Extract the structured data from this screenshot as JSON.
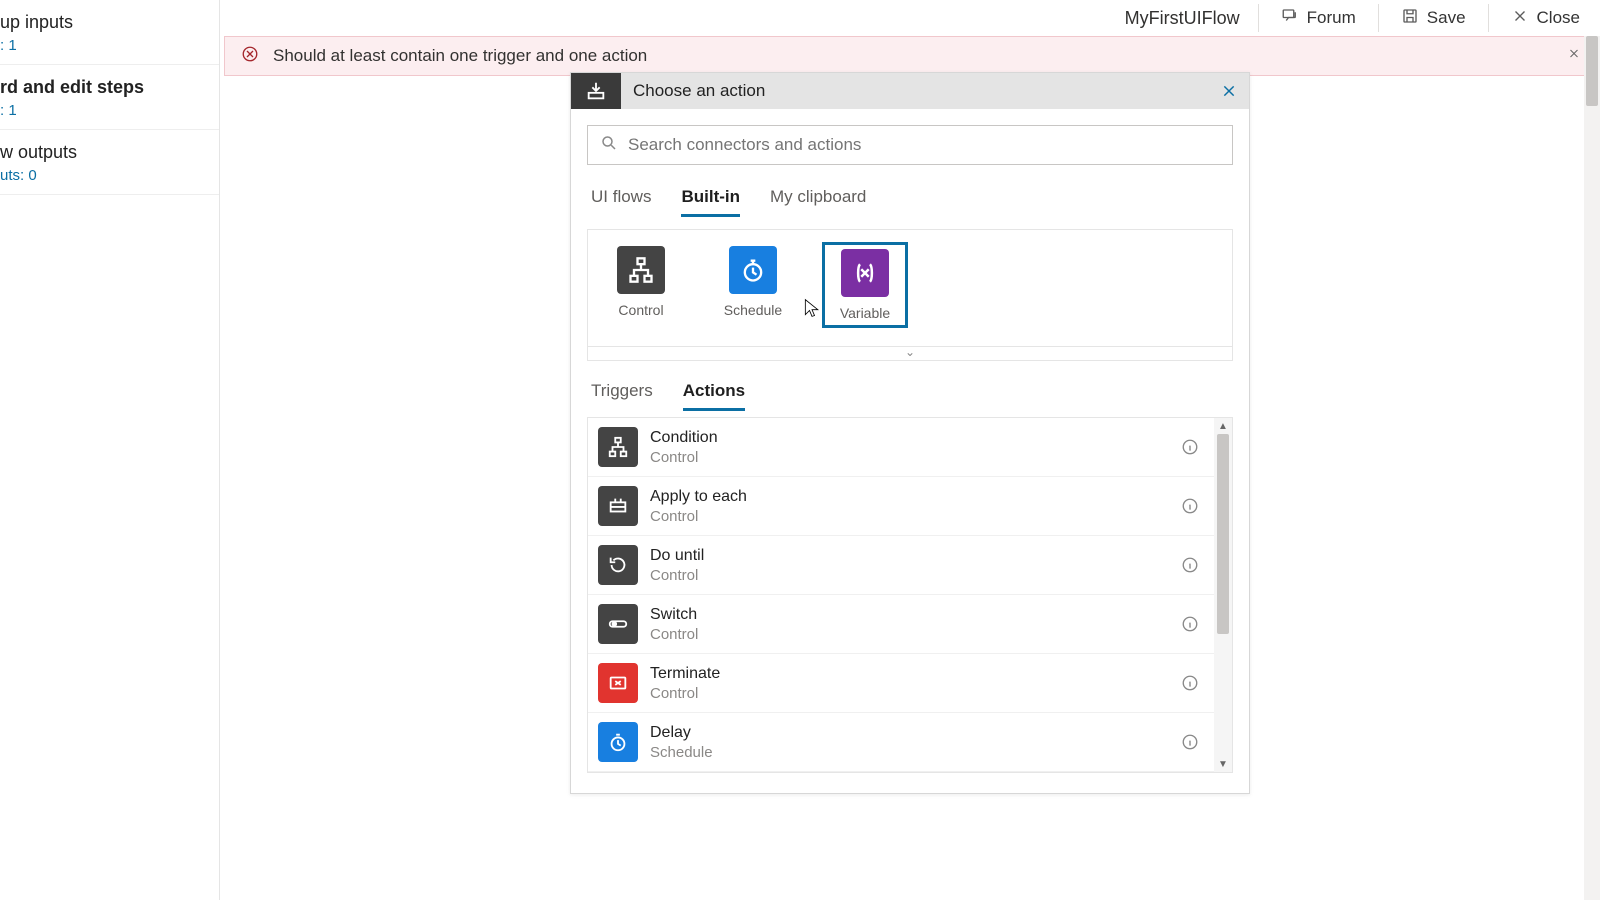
{
  "topbar": {
    "flow_name": "MyFirstUIFlow",
    "forum": "Forum",
    "save": "Save",
    "close": "Close"
  },
  "sidebar": {
    "groups": [
      {
        "title": "up inputs",
        "sub": ": 1",
        "bold": false
      },
      {
        "title": "rd and edit steps",
        "sub": ": 1",
        "bold": true
      },
      {
        "title": "w outputs",
        "sub": "uts: 0",
        "bold": false
      }
    ]
  },
  "banner": {
    "message": "Should at least contain one trigger and one action"
  },
  "card": {
    "title": "Choose an action",
    "search_placeholder": "Search connectors and actions",
    "pivot": {
      "uiflows": "UI flows",
      "builtin": "Built-in",
      "clipboard": "My clipboard"
    },
    "tiles": {
      "control": "Control",
      "schedule": "Schedule",
      "variable": "Variable"
    },
    "subpivot": {
      "triggers": "Triggers",
      "actions": "Actions"
    },
    "actions": [
      {
        "name": "Condition",
        "cat": "Control",
        "color": "#444"
      },
      {
        "name": "Apply to each",
        "cat": "Control",
        "color": "#444"
      },
      {
        "name": "Do until",
        "cat": "Control",
        "color": "#444"
      },
      {
        "name": "Switch",
        "cat": "Control",
        "color": "#444"
      },
      {
        "name": "Terminate",
        "cat": "Control",
        "color": "#e1342f"
      },
      {
        "name": "Delay",
        "cat": "Schedule",
        "color": "#187fe0"
      }
    ]
  }
}
